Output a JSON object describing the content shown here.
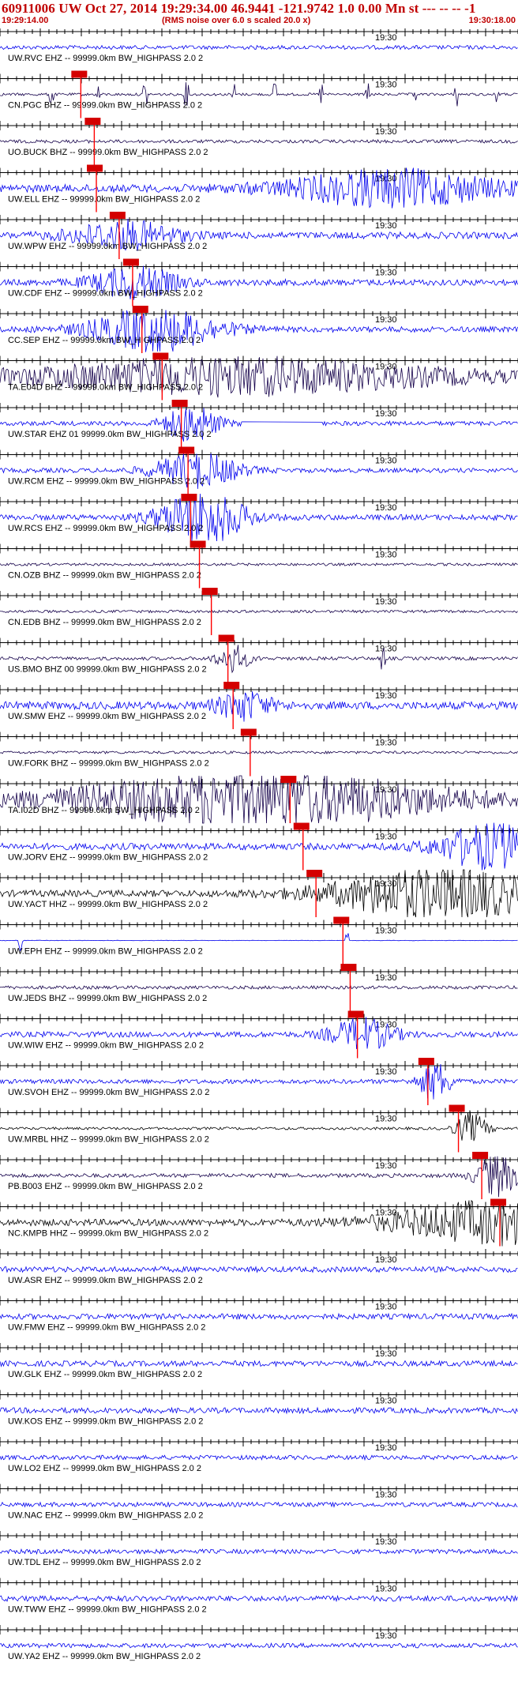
{
  "header": {
    "title": "60911006 UW Oct 27, 2014 19:29:34.00   46.9441 -121.9742   1.0 0.00 Mn st --- -- --   -1",
    "start_time": "19:29:14.00",
    "rms_note": "(RMS noise over 6.0 s scaled 20.0 x)",
    "end_time": "19:30:18.00"
  },
  "minute_label": "19:30",
  "colors": {
    "header_text": "#c00000",
    "pick_line": "#ff0000",
    "pick_box": "#d40000",
    "trace_blue": "#0000ee",
    "trace_navy": "#14004a",
    "trace_black": "#000000",
    "axis": "#000000"
  },
  "traces": [
    {
      "label": "UW.RVC EHZ -- 99999.0km BW_HIGHPASS  2.0  2",
      "color": "blue",
      "amp": 0.18,
      "pick": null,
      "burst": null,
      "spikes": []
    },
    {
      "label": "CN.PGC BHZ -- 99999.0km BW_HIGHPASS  2.0  2",
      "color": "navy",
      "amp": 0.12,
      "pick": 0.156,
      "burst": null,
      "spikes": [
        0.1,
        0.19,
        0.28,
        0.36,
        0.45,
        0.53,
        0.62,
        0.71,
        0.8,
        0.88,
        0.96
      ]
    },
    {
      "label": "UO.BUCK BHZ -- 99999.0km BW_HIGHPASS  2.0  2",
      "color": "navy",
      "amp": 0.15,
      "pick": 0.182,
      "burst": null,
      "spikes": []
    },
    {
      "label": "UW.ELL EHZ -- 99999.0km BW_HIGHPASS  2.0  2",
      "color": "blue",
      "amp": 0.35,
      "pick": 0.186,
      "burst": [
        0.76,
        0.2,
        1.0
      ],
      "spikes": []
    },
    {
      "label": "UW.WPW EHZ -- 99999.0km BW_HIGHPASS  2.0  2",
      "color": "blue",
      "amp": 0.3,
      "pick": 0.23,
      "burst": [
        0.24,
        0.1,
        0.8
      ],
      "spikes": []
    },
    {
      "label": "UW.CDF EHZ -- 99999.0km BW_HIGHPASS  2.0  2",
      "color": "blue",
      "amp": 0.28,
      "pick": 0.256,
      "burst": [
        0.26,
        0.08,
        0.9
      ],
      "spikes": []
    },
    {
      "label": "CC.SEP EHZ -- 99999.0km BW_HIGHPASS  2.0  2",
      "color": "blue",
      "amp": 0.25,
      "pick": 0.274,
      "burst": [
        0.3,
        0.12,
        1.2
      ],
      "spikes": []
    },
    {
      "label": "TA.E04D BHZ -- 99999.0km BW_HIGHPASS  2.0  2",
      "color": "navy",
      "amp": 0.35,
      "pick": 0.313,
      "burst": [
        0.45,
        0.4,
        1.0
      ],
      "spikes": []
    },
    {
      "label": "UW.STAR EHZ 01 99999.0km BW_HIGHPASS  2.0  2",
      "color": "blue",
      "amp": 0.2,
      "pick": 0.35,
      "burst": [
        0.37,
        0.05,
        1.1
      ],
      "spikes": [],
      "gap": [
        0.47,
        0.62
      ]
    },
    {
      "label": "UW.RCM EHZ -- 99999.0km BW_HIGHPASS  2.0  2",
      "color": "blue",
      "amp": 0.2,
      "pick": 0.363,
      "burst": [
        0.38,
        0.08,
        1.0
      ],
      "spikes": []
    },
    {
      "label": "UW.RCS EHZ -- 99999.0km BW_HIGHPASS  2.0  2",
      "color": "blue",
      "amp": 0.25,
      "pick": 0.368,
      "burst": [
        0.39,
        0.08,
        1.6
      ],
      "spikes": []
    },
    {
      "label": "CN.OZB BHZ -- 99999.0km BW_HIGHPASS  2.0  2",
      "color": "navy",
      "amp": 0.12,
      "pick": 0.385,
      "burst": null,
      "spikes": []
    },
    {
      "label": "CN.EDB BHZ -- 99999.0km BW_HIGHPASS  2.0  2",
      "color": "navy",
      "amp": 0.12,
      "pick": 0.408,
      "burst": null,
      "spikes": []
    },
    {
      "label": "US.BMO BHZ 00 99999.0km BW_HIGHPASS  2.0  2",
      "color": "navy",
      "amp": 0.15,
      "pick": 0.44,
      "burst": [
        0.45,
        0.03,
        0.8
      ],
      "spikes": [
        0.74
      ]
    },
    {
      "label": "UW.SMW EHZ -- 99999.0km BW_HIGHPASS  2.0  2",
      "color": "blue",
      "amp": 0.35,
      "pick": 0.45,
      "burst": [
        0.47,
        0.05,
        0.8
      ],
      "spikes": []
    },
    {
      "label": "UW.FORK BHZ -- 99999.0km BW_HIGHPASS  2.0  2",
      "color": "navy",
      "amp": 0.12,
      "pick": 0.483,
      "burst": null,
      "spikes": []
    },
    {
      "label": "TA.I02D BHZ -- 99999.0km BW_HIGHPASS  2.0  2",
      "color": "navy",
      "amp": 0.4,
      "pick": 0.56,
      "burst": [
        0.5,
        0.35,
        1.5
      ],
      "spikes": []
    },
    {
      "label": "UW.JORV EHZ -- 99999.0km BW_HIGHPASS  2.0  2",
      "color": "blue",
      "amp": 0.3,
      "pick": 0.585,
      "burst": [
        0.95,
        0.1,
        1.3
      ],
      "spikes": []
    },
    {
      "label": "UW.YACT HHZ -- 99999.0km BW_HIGHPASS  2.0  2",
      "color": "black",
      "amp": 0.3,
      "pick": 0.61,
      "burst": [
        0.85,
        0.2,
        1.5
      ],
      "spikes": []
    },
    {
      "label": "UW.EPH EHZ -- 99999.0km BW_HIGHPASS  2.0  2",
      "color": "blue",
      "amp": 0.02,
      "pick": 0.662,
      "burst": null,
      "spikes": [
        0.04,
        0.67
      ]
    },
    {
      "label": "UW.JEDS BHZ -- 99999.0km BW_HIGHPASS  2.0  2",
      "color": "navy",
      "amp": 0.15,
      "pick": 0.676,
      "burst": null,
      "spikes": []
    },
    {
      "label": "UW.WIW EHZ -- 99999.0km BW_HIGHPASS  2.0  2",
      "color": "blue",
      "amp": 0.25,
      "pick": 0.69,
      "burst": [
        0.7,
        0.06,
        0.9
      ],
      "spikes": []
    },
    {
      "label": "UW.SVOH EHZ -- 99999.0km BW_HIGHPASS  2.0  2",
      "color": "blue",
      "amp": 0.2,
      "pick": 0.826,
      "burst": [
        0.84,
        0.03,
        1.1
      ],
      "spikes": []
    },
    {
      "label": "UW.MRBL HHZ -- 99999.0km BW_HIGHPASS  2.0  2",
      "color": "black",
      "amp": 0.12,
      "pick": 0.885,
      "burst": [
        0.91,
        0.03,
        0.9
      ],
      "spikes": []
    },
    {
      "label": "PB.B003 EHZ -- 99999.0km BW_HIGHPASS  2.0  2",
      "color": "navy",
      "amp": 0.18,
      "pick": 0.93,
      "burst": [
        0.96,
        0.04,
        1.2
      ],
      "spikes": []
    },
    {
      "label": "NC.KMPB HHZ -- 99999.0km BW_HIGHPASS  2.0  2",
      "color": "black",
      "amp": 0.3,
      "pick": 0.965,
      "burst": [
        0.96,
        0.2,
        1.2
      ],
      "spikes": []
    },
    {
      "label": "UW.ASR EHZ -- 99999.0km BW_HIGHPASS  2.0  2",
      "color": "blue",
      "amp": 0.25,
      "pick": null,
      "burst": null,
      "spikes": []
    },
    {
      "label": "UW.FMW EHZ -- 99999.0km BW_HIGHPASS  2.0  2",
      "color": "blue",
      "amp": 0.25,
      "pick": null,
      "burst": null,
      "spikes": []
    },
    {
      "label": "UW.GLK EHZ -- 99999.0km BW_HIGHPASS  2.0  2",
      "color": "blue",
      "amp": 0.25,
      "pick": null,
      "burst": null,
      "spikes": []
    },
    {
      "label": "UW.KOS EHZ -- 99999.0km BW_HIGHPASS  2.0  2",
      "color": "blue",
      "amp": 0.25,
      "pick": null,
      "burst": null,
      "spikes": []
    },
    {
      "label": "UW.LO2 EHZ -- 99999.0km BW_HIGHPASS  2.0  2",
      "color": "blue",
      "amp": 0.2,
      "pick": null,
      "burst": null,
      "spikes": []
    },
    {
      "label": "UW.NAC EHZ -- 99999.0km BW_HIGHPASS  2.0  2",
      "color": "blue",
      "amp": 0.2,
      "pick": null,
      "burst": null,
      "spikes": []
    },
    {
      "label": "UW.TDL EHZ -- 99999.0km BW_HIGHPASS  2.0  2",
      "color": "blue",
      "amp": 0.2,
      "pick": null,
      "burst": null,
      "spikes": []
    },
    {
      "label": "UW.TWW EHZ -- 99999.0km BW_HIGHPASS  2.0  2",
      "color": "blue",
      "amp": 0.25,
      "pick": null,
      "burst": null,
      "spikes": []
    },
    {
      "label": "UW.YA2 EHZ -- 99999.0km BW_HIGHPASS  2.0  2",
      "color": "blue",
      "amp": 0.2,
      "pick": null,
      "burst": null,
      "spikes": []
    }
  ]
}
